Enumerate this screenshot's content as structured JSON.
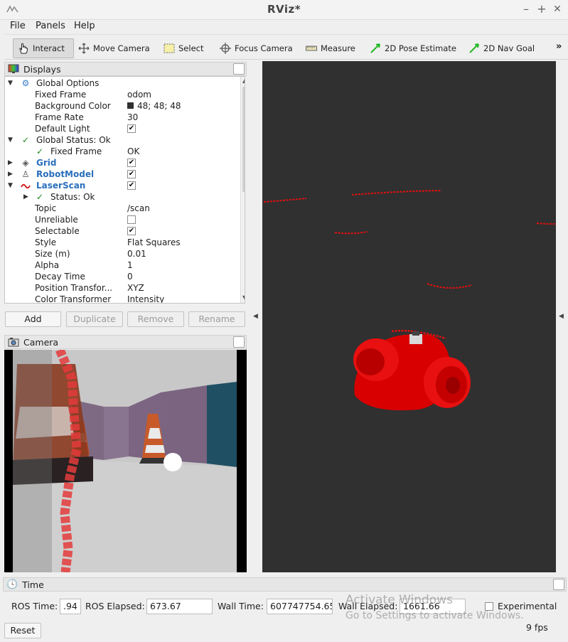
{
  "window": {
    "title": "RViz*",
    "controls": {
      "minimize": "–",
      "maximize": "+",
      "close": "✕"
    }
  },
  "menu": [
    "File",
    "Panels",
    "Help"
  ],
  "toolbar": {
    "tools": [
      "Interact",
      "Move Camera",
      "Select",
      "Focus Camera",
      "Measure",
      "2D Pose Estimate",
      "2D Nav Goal"
    ],
    "overflow": "»"
  },
  "displays": {
    "title": "Displays",
    "rows": {
      "global_options": {
        "label": "Global Options"
      },
      "fixed_frame": {
        "label": "Fixed Frame",
        "value": "odom"
      },
      "background_color": {
        "label": "Background Color",
        "value": "48; 48; 48"
      },
      "frame_rate": {
        "label": "Frame Rate",
        "value": "30"
      },
      "default_light": {
        "label": "Default Light",
        "checked": true
      },
      "global_status": {
        "label": "Global Status: Ok"
      },
      "gs_fixed_frame": {
        "label": "Fixed Frame",
        "value": "OK"
      },
      "grid": {
        "label": "Grid",
        "checked": true
      },
      "robot_model": {
        "label": "RobotModel",
        "checked": true
      },
      "laser_scan": {
        "label": "LaserScan",
        "checked": true
      },
      "ls_status": {
        "label": "Status: Ok"
      },
      "topic": {
        "label": "Topic",
        "value": "/scan"
      },
      "unreliable": {
        "label": "Unreliable",
        "checked": false
      },
      "selectable": {
        "label": "Selectable",
        "checked": true
      },
      "style": {
        "label": "Style",
        "value": "Flat Squares"
      },
      "size": {
        "label": "Size (m)",
        "value": "0.01"
      },
      "alpha": {
        "label": "Alpha",
        "value": "1"
      },
      "decay_time": {
        "label": "Decay Time",
        "value": "0"
      },
      "position_transformer": {
        "label": "Position Transfor...",
        "value": "XYZ"
      },
      "color_transformer": {
        "label": "Color Transformer",
        "value": "Intensity"
      }
    },
    "buttons": {
      "add": "Add",
      "duplicate": "Duplicate",
      "remove": "Remove",
      "rename": "Rename"
    }
  },
  "camera_panel": {
    "title": "Camera"
  },
  "time_panel": {
    "title": "Time",
    "ros_time_label": "ROS Time:",
    "ros_time": ".94",
    "ros_elapsed_label": "ROS Elapsed:",
    "ros_elapsed": "673.67",
    "wall_time_label": "Wall Time:",
    "wall_time": "607747754.65",
    "wall_elapsed_label": "Wall Elapsed:",
    "wall_elapsed": "1661.66",
    "experimental_label": "Experimental",
    "reset_label": "Reset",
    "fps": "9 fps"
  },
  "watermark": {
    "line1": "Activate Windows",
    "line2": "Go to Settings to activate Windows."
  },
  "colors": {
    "viewport_bg": "#303030",
    "laser": "#e01010",
    "robot": "#e00000",
    "accent_blue": "#2a6fbc",
    "ok_green": "#1f8a1f"
  }
}
